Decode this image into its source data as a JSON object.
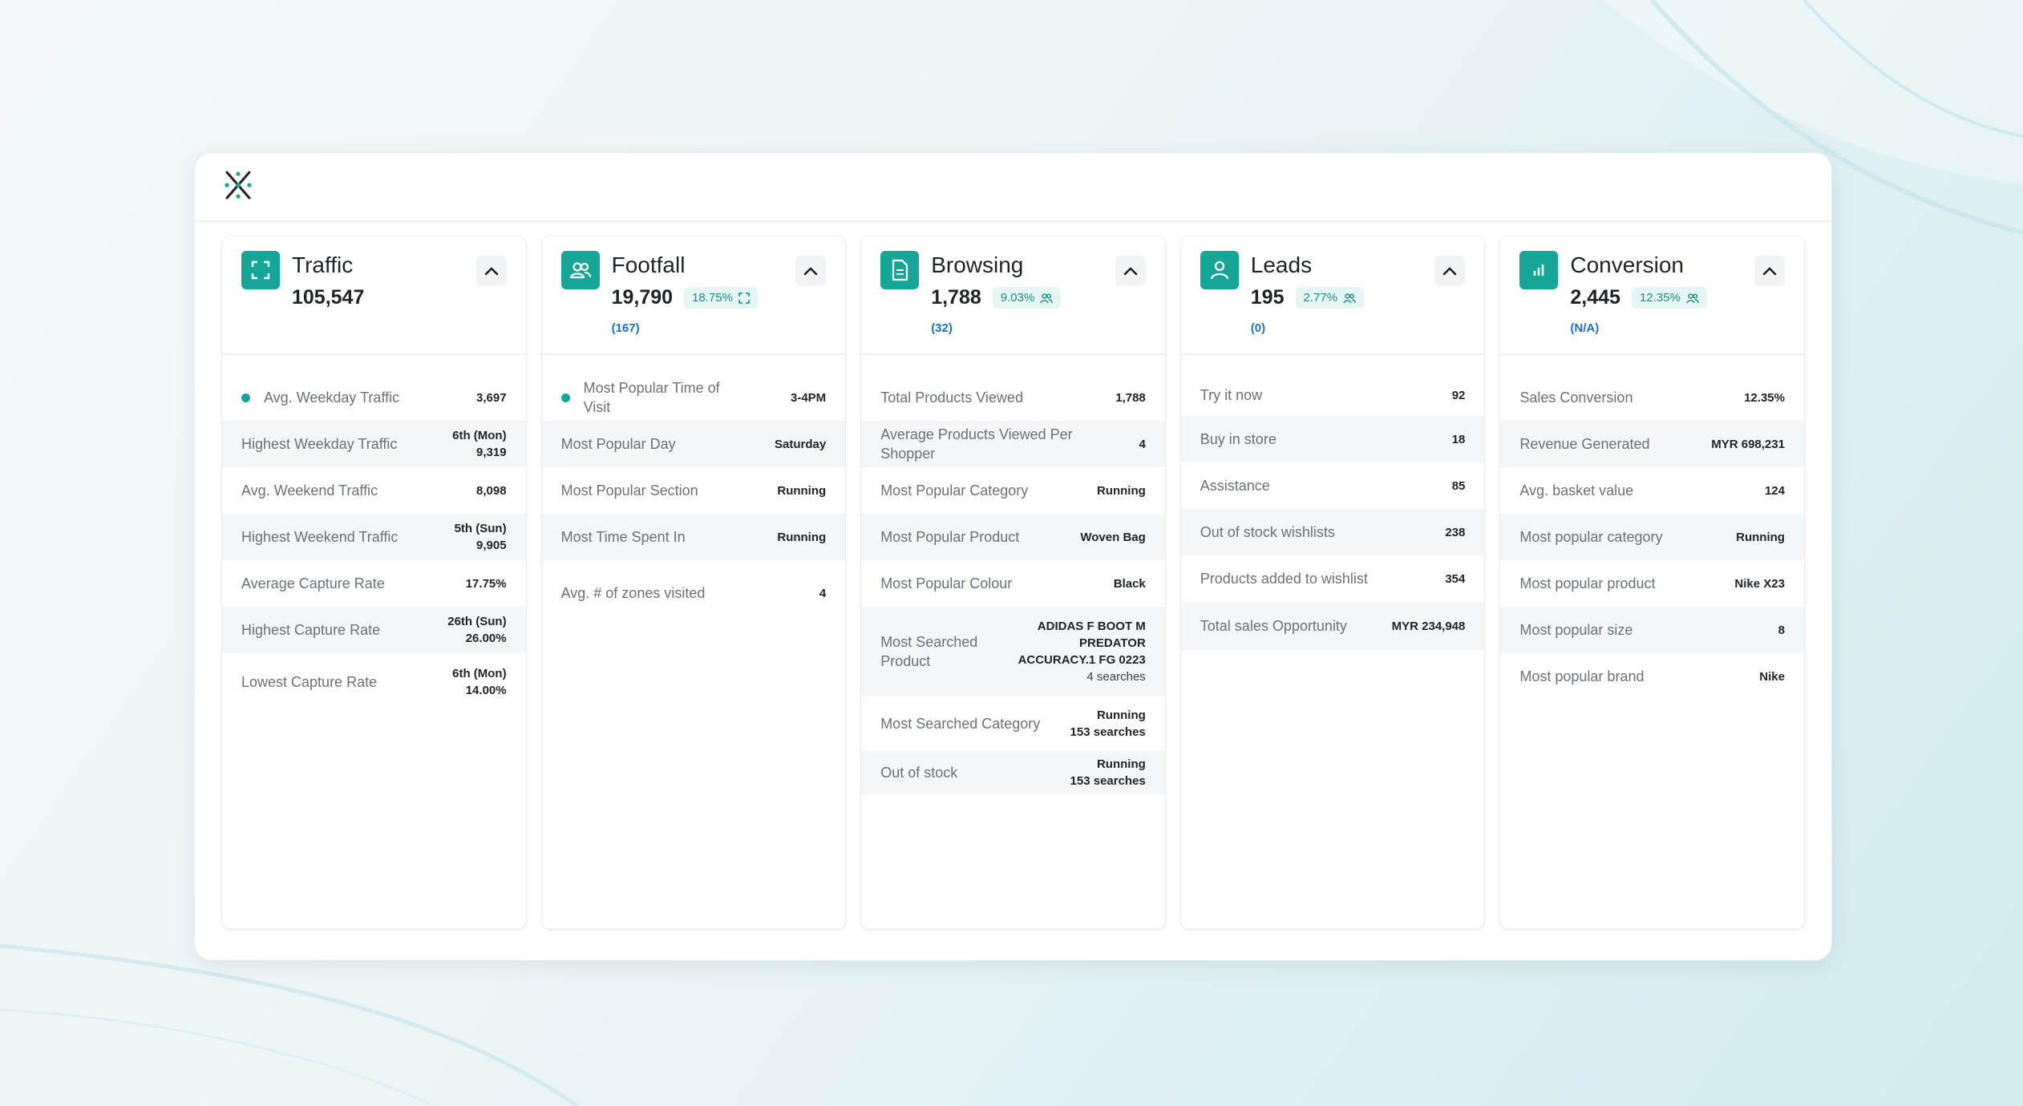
{
  "cards": [
    {
      "key": "traffic",
      "title": "Traffic",
      "icon": "scan-frame-icon",
      "value": "105,547",
      "badge": "",
      "sub": "",
      "rows": [
        {
          "label": "Avg. Weekday Traffic",
          "value": "3,697",
          "sub": "",
          "dot": true
        },
        {
          "label": "Highest Weekday Traffic",
          "value": "6th (Mon)",
          "sub": "9,319"
        },
        {
          "label": "Avg. Weekend Traffic",
          "value": "8,098",
          "sub": ""
        },
        {
          "label": "Highest Weekend Traffic",
          "value": "5th (Sun)",
          "sub": "9,905"
        },
        {
          "label": "Average Capture Rate",
          "value": "17.75%",
          "sub": ""
        },
        {
          "label": "Highest Capture Rate",
          "value": "26th (Sun)",
          "sub": "26.00%"
        },
        {
          "label": "Lowest Capture Rate",
          "value": "6th (Mon)",
          "sub": "14.00%"
        }
      ]
    },
    {
      "key": "footfall",
      "title": "Footfall",
      "icon": "people-icon",
      "value": "19,790",
      "badge": "18.75%",
      "sub": "(167)",
      "rows": [
        {
          "label": "Most Popular Time of Visit",
          "value": "3-4PM",
          "sub": "",
          "dot": true
        },
        {
          "label": "Most Popular Day",
          "value": "Saturday",
          "sub": ""
        },
        {
          "label": "Most Popular Section",
          "value": "Running",
          "sub": ""
        },
        {
          "label": "Most Time Spent In",
          "value": "Running",
          "sub": ""
        },
        {
          "label": "Avg. # of zones visited",
          "value": "4",
          "sub": ""
        }
      ]
    },
    {
      "key": "browsing",
      "title": "Browsing",
      "icon": "document-icon",
      "value": "1,788",
      "badge": "9.03%",
      "sub": "(32)",
      "rows": [
        {
          "label": "Total Products Viewed",
          "value": "1,788",
          "sub": ""
        },
        {
          "label": "Average Products Viewed Per Shopper",
          "value": "4",
          "sub": ""
        },
        {
          "label": "Most Popular Category",
          "value": "Running",
          "sub": ""
        },
        {
          "label": "Most Popular Product",
          "value": "Woven Bag",
          "sub": ""
        },
        {
          "label": "Most Popular Colour",
          "value": "Black",
          "sub": ""
        },
        {
          "label": "Most Searched Product",
          "value": "ADIDAS F BOOT M PREDATOR ACCURACY.1 FG 0223",
          "sub": "4 searches"
        },
        {
          "label": "Most Searched Category",
          "value": "Running",
          "sub": "153 searches"
        },
        {
          "label": "Out of stock",
          "value": "Running",
          "sub": "153 searches"
        }
      ]
    },
    {
      "key": "leads",
      "title": "Leads",
      "icon": "person-icon",
      "value": "195",
      "badge": "2.77%",
      "sub": "(0)",
      "rows": [
        {
          "label": "Try it now",
          "value": "92",
          "sub": ""
        },
        {
          "label": "Buy in store",
          "value": "18",
          "sub": ""
        },
        {
          "label": "Assistance",
          "value": "85",
          "sub": ""
        },
        {
          "label": "Out of stock wishlists",
          "value": "238",
          "sub": ""
        },
        {
          "label": "Products added to wishlist",
          "value": "354",
          "sub": ""
        },
        {
          "label": "Total sales Opportunity",
          "value": "MYR 234,948",
          "sub": ""
        }
      ]
    },
    {
      "key": "conversion",
      "title": "Conversion",
      "icon": "bar-chart-icon",
      "value": "2,445",
      "badge": "12.35%",
      "sub": "(N/A)",
      "rows": [
        {
          "label": "Sales Conversion",
          "value": "12.35%",
          "sub": ""
        },
        {
          "label": "Revenue Generated",
          "value": "MYR 698,231",
          "sub": ""
        },
        {
          "label": "Avg. basket value",
          "value": "124",
          "sub": ""
        },
        {
          "label": "Most popular category",
          "value": "Running",
          "sub": ""
        },
        {
          "label": "Most popular product",
          "value": "Nike X23",
          "sub": ""
        },
        {
          "label": "Most popular size",
          "value": "8",
          "sub": ""
        },
        {
          "label": "Most popular brand",
          "value": "Nike",
          "sub": ""
        }
      ]
    }
  ],
  "colors": {
    "accent": "#17a598",
    "link": "#1f6fc5",
    "badge_bg": "#e4f5f3"
  }
}
